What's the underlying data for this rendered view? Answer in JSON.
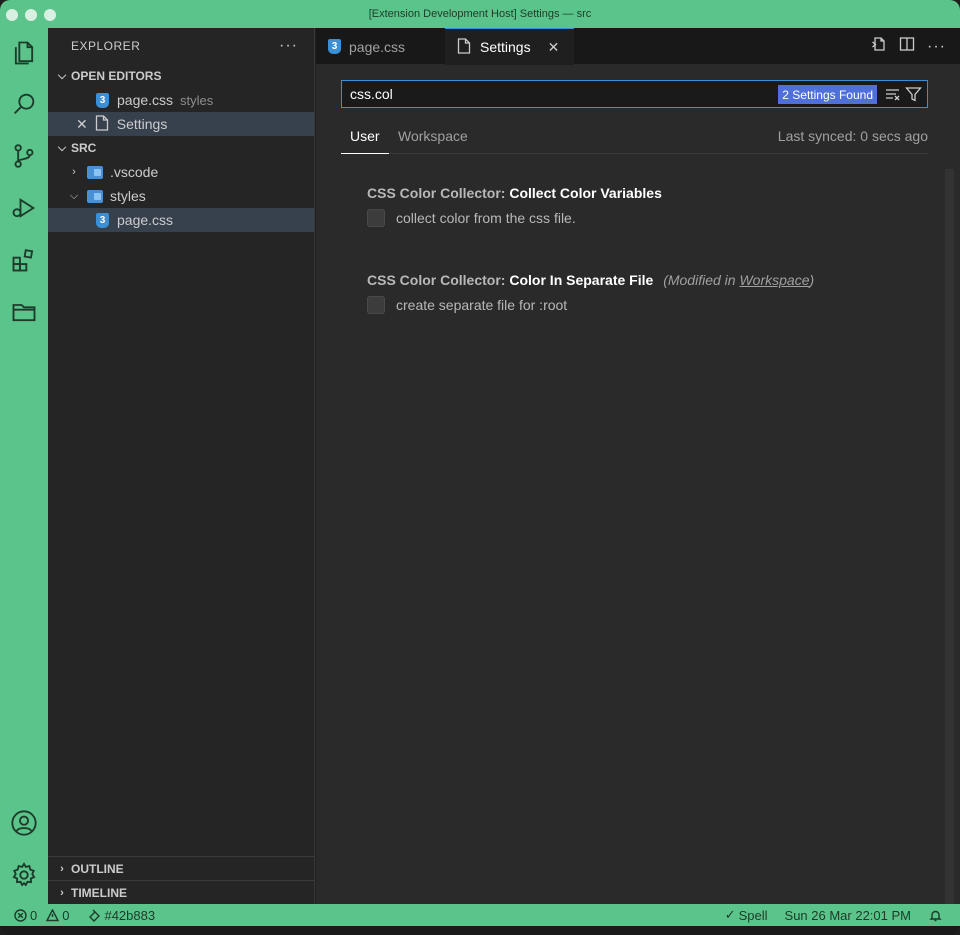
{
  "window": {
    "title": "[Extension Development Host] Settings — src"
  },
  "activity_bar": {
    "items": [
      "files-icon",
      "search-icon",
      "source-control-icon",
      "run-debug-icon",
      "extensions-icon",
      "remote-explorer-icon",
      "account-icon",
      "gear-icon"
    ]
  },
  "sidebar": {
    "title": "EXPLORER",
    "more": "···",
    "open_editors": {
      "label": "OPEN EDITORS",
      "items": [
        {
          "name": "page.css",
          "description": "styles"
        },
        {
          "name": "Settings"
        }
      ]
    },
    "folder": {
      "label": "SRC",
      "items": [
        {
          "name": ".vscode"
        },
        {
          "name": "styles"
        },
        {
          "name": "page.css"
        }
      ]
    },
    "outline_label": "OUTLINE",
    "timeline_label": "TIMELINE"
  },
  "tabs": [
    {
      "label": "page.css",
      "active": false
    },
    {
      "label": "Settings",
      "active": true
    }
  ],
  "settings": {
    "search_value": "css.col",
    "found_badge": "2 Settings Found",
    "scope_tabs": [
      "User",
      "Workspace"
    ],
    "synced_text": "Last synced: 0 secs ago",
    "items": [
      {
        "category": "CSS Color Collector: ",
        "name": "Collect Color Variables",
        "description": "collect color from the css file.",
        "checked": false
      },
      {
        "category": "CSS Color Collector: ",
        "name": "Color In Separate File",
        "modified_prefix": "(Modified in ",
        "modified_scope": "Workspace",
        "modified_suffix": ")",
        "description": "create separate file for :root",
        "checked": false
      }
    ]
  },
  "statusbar": {
    "errors": "0",
    "warnings": "0",
    "color": "#42b883",
    "spell": "Spell",
    "datetime": "Sun 26 Mar 22:01 PM"
  },
  "colors": {
    "accent": "#5bc48a",
    "badge": "#4f70d9",
    "focus_border": "#3b8fd4"
  }
}
